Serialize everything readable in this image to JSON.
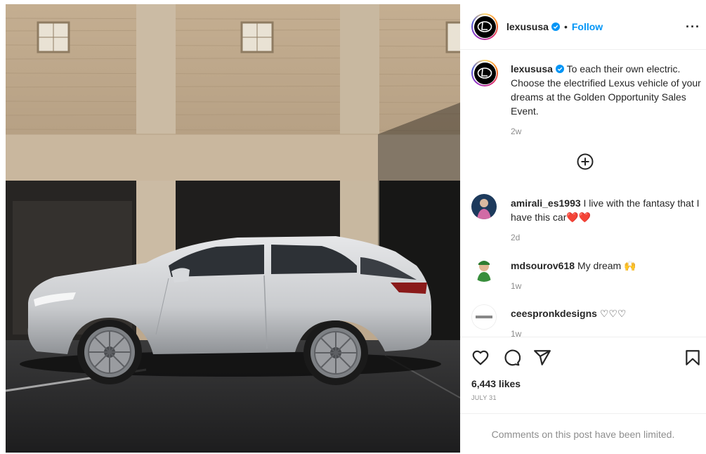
{
  "post": {
    "photo_alt": "Lexus vehicle",
    "author": "lexususa",
    "follow_label": "Follow",
    "dot": "•",
    "more_label": "···"
  },
  "caption": {
    "username": "lexususa",
    "text": "To each their own electric. Choose the electrified Lexus vehicle of your dreams at the Golden Opportunity Sales Event.",
    "time": "2w"
  },
  "comments": [
    {
      "username": "amirali_es1993",
      "text": "I live with the fantasy that I have this car❤️❤️",
      "time": "2d"
    },
    {
      "username": "mdsourov618",
      "text": "My dream 🙌",
      "time": "1w"
    },
    {
      "username": "ceespronkdesigns",
      "text": "♡♡♡",
      "time": "1w"
    }
  ],
  "engagement": {
    "likes": "6,443 likes",
    "date": "JULY 31",
    "comments_limited": "Comments on this post have been limited."
  },
  "colors": {
    "accent": "#0095f6",
    "verified": "#0095f6",
    "muted": "#8e8e8e",
    "heart": "#e0245e"
  },
  "icons": [
    "verified-icon",
    "more-icon",
    "load-more-icon",
    "like-icon",
    "comment-icon",
    "share-icon",
    "save-icon"
  ]
}
